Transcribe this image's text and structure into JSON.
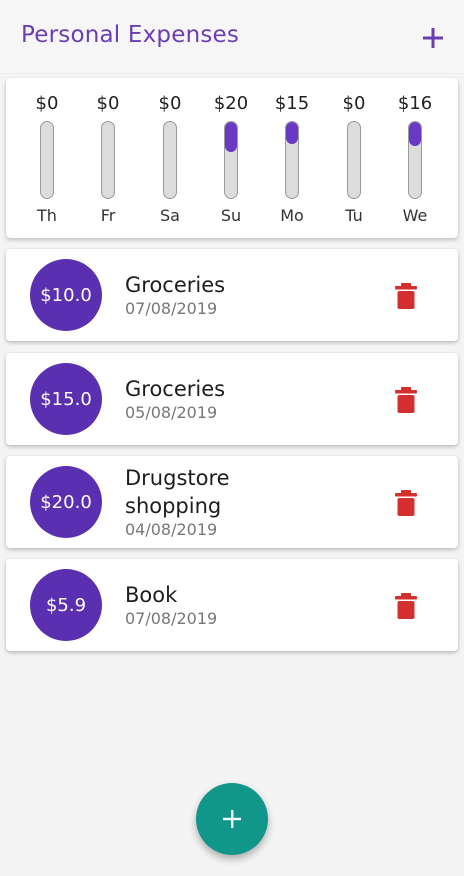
{
  "appbar": {
    "title": "Personal Expenses",
    "add_icon": "plus-icon"
  },
  "colors": {
    "accent": "#6a3eb0",
    "bar_fill": "#6a39c4",
    "amount_circle": "#5a2fb0",
    "delete": "#d32f2f",
    "fab": "#11978a"
  },
  "chart": {
    "bars": [
      {
        "day": "Th",
        "amount": "$0",
        "fraction": 0
      },
      {
        "day": "Fr",
        "amount": "$0",
        "fraction": 0
      },
      {
        "day": "Sa",
        "amount": "$0",
        "fraction": 0
      },
      {
        "day": "Su",
        "amount": "$20",
        "fraction": 0.392
      },
      {
        "day": "Mo",
        "amount": "$15",
        "fraction": 0.294
      },
      {
        "day": "Tu",
        "amount": "$0",
        "fraction": 0
      },
      {
        "day": "We",
        "amount": "$16",
        "fraction": 0.314
      }
    ]
  },
  "transactions": [
    {
      "amount": "$10.0",
      "title": "Groceries",
      "date": "07/08/2019"
    },
    {
      "amount": "$15.0",
      "title": "Groceries",
      "date": "05/08/2019"
    },
    {
      "amount": "$20.0",
      "title": "Drugstore shopping",
      "date": "04/08/2019"
    },
    {
      "amount": "$5.9",
      "title": "Book",
      "date": "07/08/2019"
    }
  ],
  "fab": {
    "icon": "plus-icon"
  },
  "delete_icon": "trash-icon"
}
